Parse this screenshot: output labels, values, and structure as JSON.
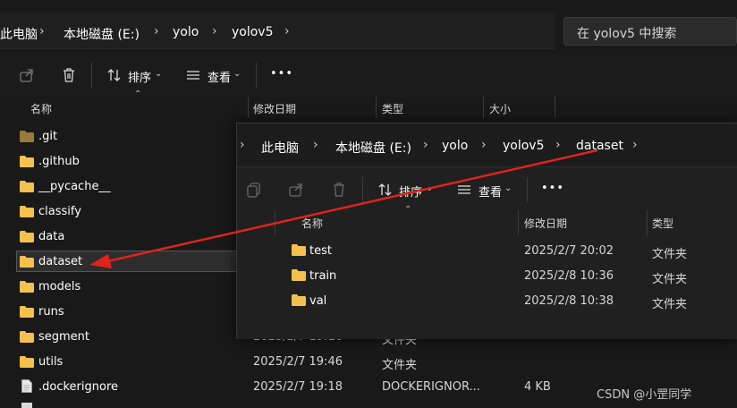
{
  "breadcrumb": [
    "此电脑",
    "本地磁盘 (E:)",
    "yolo",
    "yolov5"
  ],
  "search": {
    "placeholder": "在 yolov5 中搜索"
  },
  "toolbar": {
    "sort": "排序",
    "view": "查看",
    "more": "•••"
  },
  "columns": {
    "name": "名称",
    "date": "修改日期",
    "type": "类型",
    "size": "大小"
  },
  "rows": [
    {
      "name": ".git",
      "date": "",
      "type": "",
      "size": ""
    },
    {
      "name": ".github",
      "date": "",
      "type": "",
      "size": ""
    },
    {
      "name": "__pycache__",
      "date": "",
      "type": "",
      "size": ""
    },
    {
      "name": "classify",
      "date": "",
      "type": "",
      "size": ""
    },
    {
      "name": "data",
      "date": "",
      "type": "",
      "size": ""
    },
    {
      "name": "dataset",
      "date": "",
      "type": "",
      "size": ""
    },
    {
      "name": "models",
      "date": "",
      "type": "",
      "size": ""
    },
    {
      "name": "runs",
      "date": "",
      "type": "",
      "size": ""
    },
    {
      "name": "segment",
      "date": "2025/2/7 19:16",
      "type": "文件夹",
      "size": ""
    },
    {
      "name": "utils",
      "date": "2025/2/7 19:46",
      "type": "文件夹",
      "size": ""
    },
    {
      "name": ".dockerignore",
      "date": "2025/2/7 19:18",
      "type": "DOCKERIGNOR...",
      "size": "4 KB"
    }
  ],
  "popup": {
    "breadcrumb": [
      "此电脑",
      "本地磁盘 (E:)",
      "yolo",
      "yolov5",
      "dataset"
    ],
    "toolbar": {
      "sort": "排序",
      "view": "查看",
      "more": "•••"
    },
    "columns": {
      "name": "名称",
      "date": "修改日期",
      "type": "类型"
    },
    "rows": [
      {
        "name": "test",
        "date": "2025/2/7 20:02",
        "type": "文件夹"
      },
      {
        "name": "train",
        "date": "2025/2/8 10:36",
        "type": "文件夹"
      },
      {
        "name": "val",
        "date": "2025/2/8 10:38",
        "type": "文件夹"
      }
    ]
  },
  "watermark": "CSDN @小罡同学",
  "colors": {
    "background": "#191919",
    "selection": "#2d2d2d",
    "folder": "#f2c14e",
    "arrow": "#e0241b"
  },
  "icons": [
    "share-icon",
    "delete-icon",
    "sort-icon",
    "view-icon",
    "chevron-right-icon",
    "folder-icon",
    "file-icon",
    "copy-icon"
  ]
}
